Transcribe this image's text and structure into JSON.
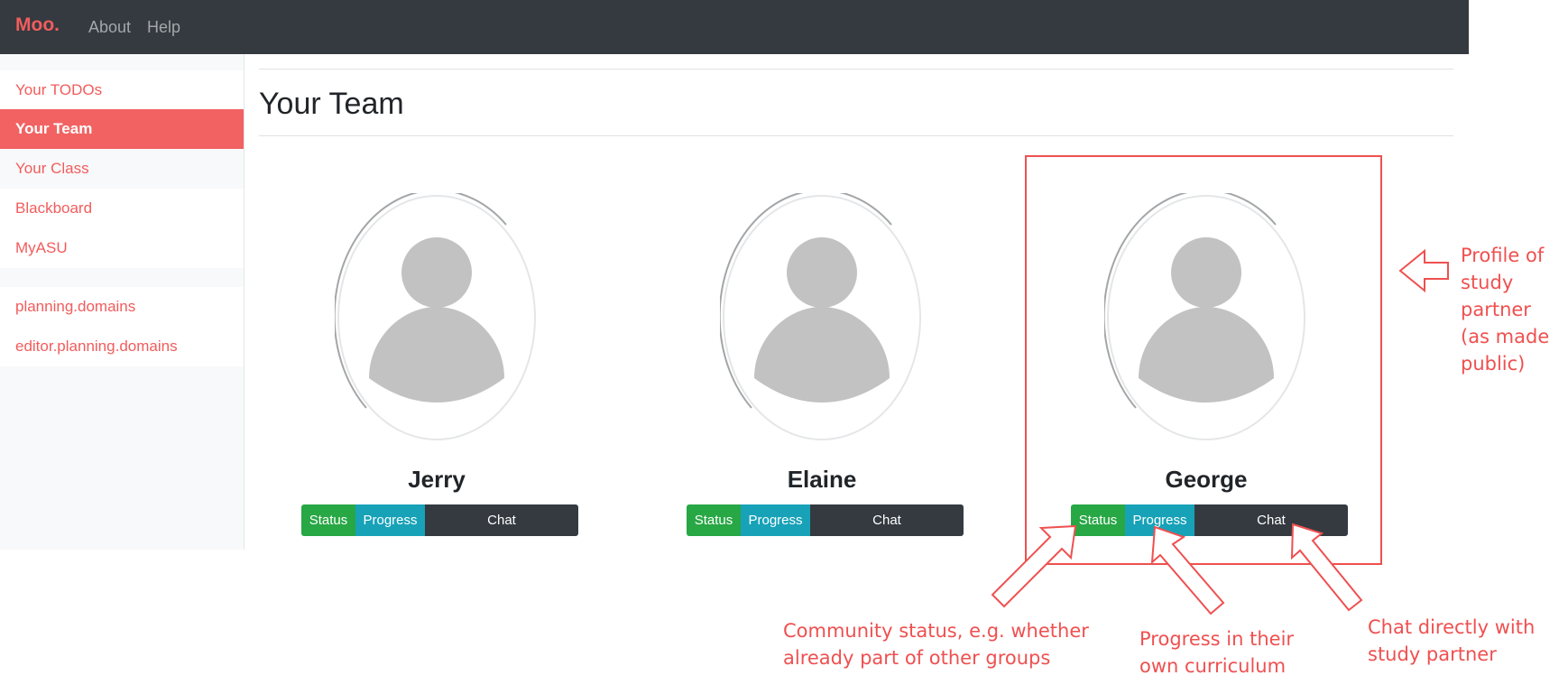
{
  "navbar": {
    "brand": "Moo.",
    "links": [
      "About",
      "Help"
    ]
  },
  "sidebar": {
    "items": [
      {
        "label": "Your TODOs",
        "active": false
      },
      {
        "label": "Your Team",
        "active": true
      },
      {
        "label": "Your Class",
        "active": false
      },
      {
        "label": "Blackboard",
        "active": false
      },
      {
        "label": "MyASU",
        "active": false
      }
    ],
    "external": [
      {
        "label": "planning.domains"
      },
      {
        "label": "editor.planning.domains"
      }
    ]
  },
  "main": {
    "title": "Your Team",
    "members": [
      {
        "name": "Jerry",
        "buttons": {
          "status": "Status",
          "progress": "Progress",
          "chat": "Chat"
        }
      },
      {
        "name": "Elaine",
        "buttons": {
          "status": "Status",
          "progress": "Progress",
          "chat": "Chat"
        }
      },
      {
        "name": "George",
        "buttons": {
          "status": "Status",
          "progress": "Progress",
          "chat": "Chat"
        }
      }
    ]
  },
  "annotations": {
    "profile": [
      "Profile of",
      "study",
      "partner",
      "(as made",
      "public)"
    ],
    "status": [
      "Community status, e.g. whether",
      "already part of other groups"
    ],
    "progress": [
      "Progress in their",
      "own curriculum"
    ],
    "chat": [
      "Chat directly with",
      "study partner"
    ]
  },
  "colors": {
    "accent": "#f25c5c",
    "navbar": "#343a40",
    "status": "#28a745",
    "progress": "#17a2b8",
    "chat": "#343a40",
    "annotation": "#ef5050"
  },
  "icons": {
    "avatar": "person-placeholder-icon",
    "arrows": "outline-arrow-icon"
  }
}
